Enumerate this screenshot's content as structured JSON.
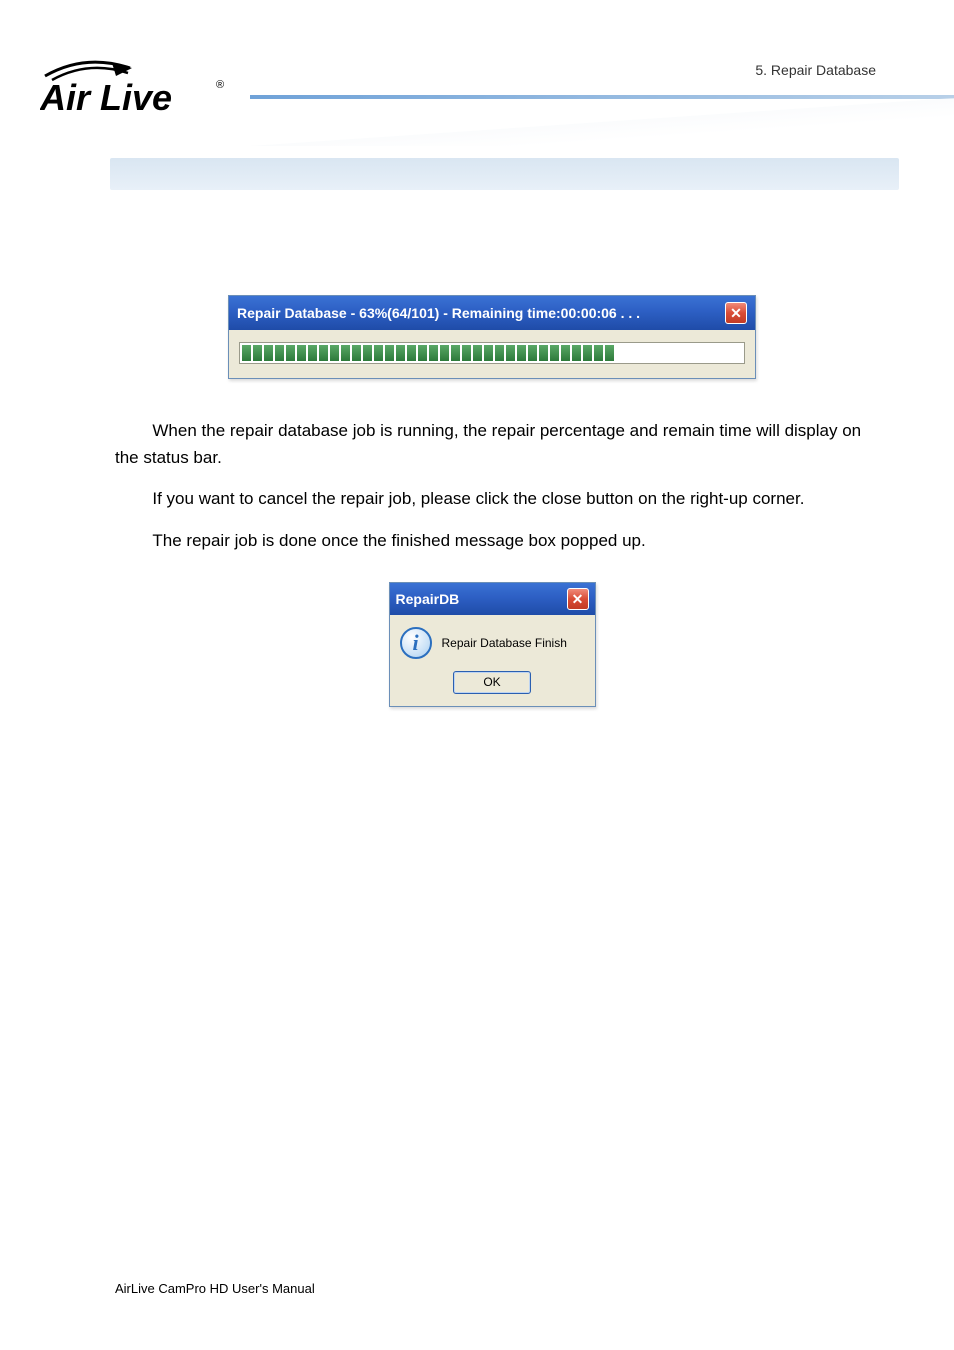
{
  "header": {
    "chapter": "5. Repair Database"
  },
  "progress_dialog": {
    "title": "Repair Database - 63%(64/101) - Remaining time:00:00:06 . . .",
    "close_glyph": "✕",
    "segments": 34
  },
  "paragraphs": {
    "p1": "When the repair database job is running, the repair percentage and remain time will display on the status bar.",
    "p2": "If you want to cancel the repair job, please click the close button on the right-up corner.",
    "p3": "The repair job is done once the finished message box popped up."
  },
  "message_dialog": {
    "title": "RepairDB",
    "close_glyph": "✕",
    "info_glyph": "i",
    "text": "Repair Database Finish",
    "ok_label": "OK"
  },
  "footer": {
    "text": "AirLive CamPro HD User's Manual"
  }
}
